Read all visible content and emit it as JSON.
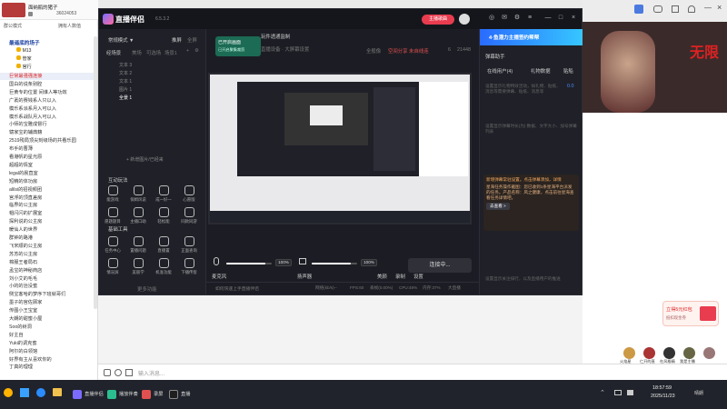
{
  "left": {
    "nickname": "面纳瓶的猪子",
    "uid": "36024053",
    "tabs": [
      "群公模式",
      "拥有人数值"
    ],
    "group_name": "最遥底的场子",
    "members": [
      "M13 ",
      "管家",
      "官行"
    ],
    "rows": [
      {
        "text": "巨常最强强连接",
        "style": "red"
      },
      {
        "text": "国白的说条别腔",
        "style": ""
      },
      {
        "text": "巨黄专的位置 间谁人等功效",
        "style": ""
      },
      {
        "text": "广袤的赛钱系人只以入",
        "style": ""
      },
      {
        "text": "模乐系派系月入可以入",
        "style": ""
      },
      {
        "text": "模乐系战队月入可以入",
        "style": ""
      },
      {
        "text": "小师的宝雅成督行",
        "style": ""
      },
      {
        "text": "辕家宝的辅典籍",
        "style": ""
      },
      {
        "text": "2519残局顶尖刻级场的共看乐园",
        "style": ""
      },
      {
        "text": "布手的曹薄",
        "style": ""
      },
      {
        "text": "看港帆的星光原",
        "style": ""
      },
      {
        "text": "超超的情室",
        "style": ""
      },
      {
        "text": "legal的晨直室",
        "style": ""
      },
      {
        "text": "短精的体功房",
        "style": ""
      },
      {
        "text": "alilsi的招视频团",
        "style": ""
      },
      {
        "text": "宫浮的顶直差房",
        "style": ""
      },
      {
        "text": "临界的公主房",
        "style": ""
      },
      {
        "text": "帽闪闪的扩展室",
        "style": ""
      },
      {
        "text": "探利说的公主房",
        "style": ""
      },
      {
        "text": "暖仙人的世界",
        "style": ""
      },
      {
        "text": "群钟的路港",
        "style": ""
      },
      {
        "text": "飞宋顺的公主房",
        "style": ""
      },
      {
        "text": "苏苏的公主房",
        "style": ""
      },
      {
        "text": "棉服王者局石",
        "style": ""
      },
      {
        "text": "孟宝的神秘商店",
        "style": ""
      },
      {
        "text": "刘小艾的毛毛",
        "style": ""
      },
      {
        "text": "小的的治没蜜",
        "style": ""
      },
      {
        "text": "侧宝客哈的梦序下班就哥们",
        "style": ""
      },
      {
        "text": "墨子的宫佐顾家",
        "style": ""
      },
      {
        "text": "传图小王宝室",
        "style": ""
      },
      {
        "text": "大朗的甜蜜小屋",
        "style": ""
      },
      {
        "text": "Soo的树洞",
        "style": ""
      },
      {
        "text": "好主自",
        "style": ""
      },
      {
        "text": "Yuki的调克蜜",
        "style": ""
      },
      {
        "text": "阿尔的白领馆",
        "style": ""
      },
      {
        "text": "好界有主从喜欢你的",
        "style": ""
      },
      {
        "text": "丁真的理理",
        "style": ""
      }
    ]
  },
  "app": {
    "title": "直播伴侣",
    "version": "6.5.3.2",
    "host_button": "主播歌曲",
    "mode_label": "常规模式 ▼",
    "tabs_top": [
      "推屏",
      "全屏"
    ],
    "scene_tabs": [
      "经场景",
      "美场",
      "可选场",
      "场景1"
    ],
    "scenes": [
      "文本 3",
      "文本 2",
      "文本 1",
      "图片 1",
      "全景 1"
    ],
    "add_source": "+ 新增图片/已经来",
    "interact_title": "互动玩法",
    "interact_tools": [
      "能游戏",
      "保姆风说",
      "成一好一",
      "心愿版",
      "愿题题目",
      "主播口助",
      "轻松能",
      "同款同游"
    ],
    "basic_title": "基础工具",
    "basic_tools": [
      "任务中心",
      "置播问题",
      "直播置",
      "正面查询",
      "情况屏",
      "美丽学",
      "机准功能",
      "下播传客"
    ],
    "more_tools": "更多功能",
    "preview_title": "玩件透通监制",
    "preview_badge": "已开启画面",
    "preview_badge_sub": "已开启聚集裁剪",
    "preview_sub": "直播设备 · 大屏幕设置",
    "full_screen": "全般像",
    "privacy": "空间分享 未自线连",
    "likes": "6",
    "viewers": "21448",
    "mic_label": "麦克风",
    "mic_pct": "100%",
    "mic_level": 0.85,
    "spk_label": "扬声器",
    "spk_pct": "100%",
    "spk_level": 0.85,
    "ctrl_labels": [
      "美颜",
      "录制",
      "设置"
    ],
    "go_live": "连接中...",
    "status_left": "如何快速上手直播伴侣",
    "status_right": [
      "网络(kb/s)--",
      "FPS:60",
      "丢帧(0.00%)",
      "CPU:48%",
      "内存:37%",
      "大直播"
    ]
  },
  "right": {
    "header_links": [
      "分享直播",
      "分享"
    ],
    "promo": "4·鱼潜力主播签约帮帮",
    "panel_title": "弹幕助手",
    "tabs": [
      "在线用户(4)",
      "礼物数据",
      "贴船"
    ],
    "hint1": "设置显示礼物特效活动，如礼物、贴纸、消息等需要弹幕、贴纸、消息等",
    "score": "0.0",
    "hint2": "设置显示弹幕时长(为) 数据、文字大小、加号弹幕列表",
    "notice_title": "新增弹幕常驻设置。点击弹幕添加，详情",
    "notice_text": "星海任务操作截图：您已收到1条星海平台派发的任务。产品名称：风之健康，点击前往星海查看任务详情吧。",
    "notice_btn": "去查看 >",
    "hint3": "设置显示关注排行，以及直播用户的推送",
    "wall_text": "无限",
    "red_packet": "立得5元红包",
    "red_packet_sub": "抵扣现金券",
    "avatars": [
      "A1",
      "A2",
      "A3",
      "A4",
      "A5"
    ],
    "avatar_names": [
      "火焰星",
      "仁开的直",
      "在风格精",
      "我是主播"
    ]
  },
  "chat_input": {
    "placeholder": "输入消息..."
  },
  "taskbar": {
    "apps": [
      "直播伴侣",
      "播放伴奏",
      "录屏",
      "直播"
    ],
    "time": "18:57:59",
    "date": "2025/11/23",
    "weather": "晴朗"
  },
  "colors": {
    "accent": "#e93c4f",
    "app_bg": "#1c1d24",
    "promo_blue": "#2a6bff"
  }
}
